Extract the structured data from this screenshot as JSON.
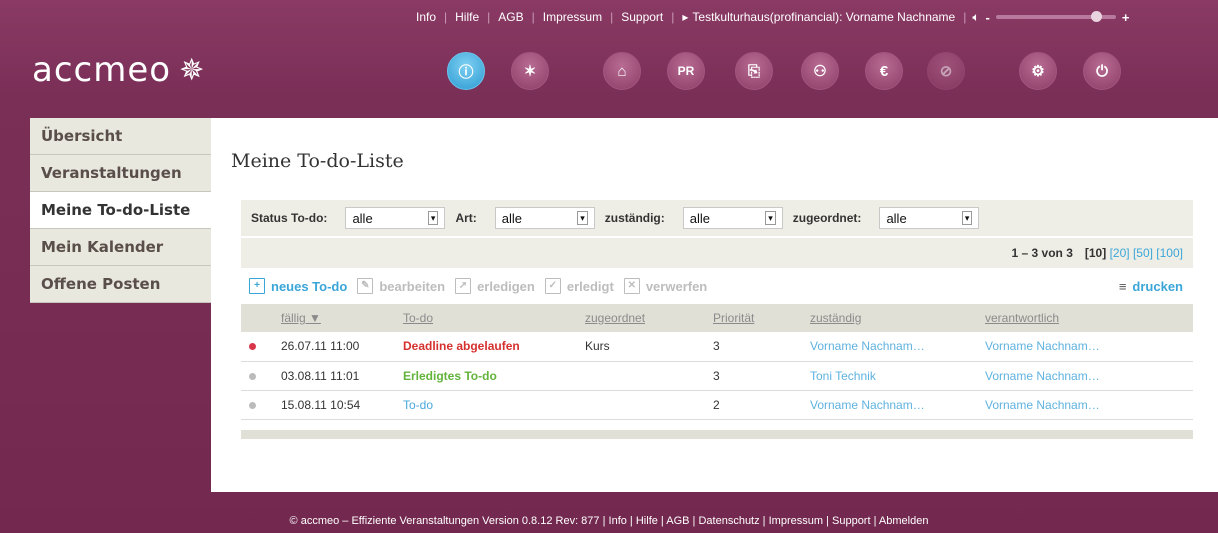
{
  "top_links": [
    "Info",
    "Hilfe",
    "AGB",
    "Impressum",
    "Support"
  ],
  "user_label": "Testkulturhaus(profinancial): Vorname Nachname",
  "volume": {
    "minus": "-",
    "plus": "+",
    "level": 0.85
  },
  "logo": "accmeo",
  "toolbar_icons": [
    {
      "name": "info-icon",
      "glyph": "ⓘ",
      "active": true
    },
    {
      "name": "network-icon",
      "glyph": "✶"
    },
    {
      "name": "home-icon",
      "glyph": "⌂"
    },
    {
      "name": "pr-icon",
      "glyph": "PR"
    },
    {
      "name": "attachment-icon",
      "glyph": "⎘"
    },
    {
      "name": "people-icon",
      "glyph": "⚇"
    },
    {
      "name": "euro-icon",
      "glyph": "€"
    },
    {
      "name": "disabled-icon",
      "glyph": "⊘",
      "dim": true
    },
    {
      "name": "settings-icon",
      "glyph": "⚙"
    },
    {
      "name": "power-icon",
      "glyph": "⏻"
    }
  ],
  "sidebar": {
    "items": [
      {
        "label": "Übersicht"
      },
      {
        "label": "Veranstaltungen"
      },
      {
        "label": "Meine To-do-Liste",
        "active": true
      },
      {
        "label": "Mein Kalender"
      },
      {
        "label": "Offene Posten"
      }
    ]
  },
  "page_title": "Meine To-do-Liste",
  "filter": {
    "status_label": "Status To-do:",
    "status_value": "alle",
    "art_label": "Art:",
    "art_value": "alle",
    "zustaendig_label": "zuständig:",
    "zustaendig_value": "alle",
    "zugeordnet_label": "zugeordnet:",
    "zugeordnet_value": "alle"
  },
  "pager": {
    "range": "1 – 3 von 3",
    "current": "[10]",
    "options": [
      "[20]",
      "[50]",
      "[100]"
    ]
  },
  "actions": {
    "new": "neues To-do",
    "edit": "bearbeiten",
    "complete": "erledigen",
    "done": "erledigt",
    "discard": "verwerfen",
    "print": "drucken"
  },
  "table": {
    "headers": [
      "fällig ▼",
      "To-do",
      "zugeordnet",
      "Priorität",
      "zuständig",
      "verantwortlich"
    ],
    "rows": [
      {
        "due": "26.07.11 11:00",
        "todo": "Deadline abgelaufen",
        "assigned": "Kurs",
        "priority": "3",
        "responsible": "Vorname Nachnam…",
        "accountable": "Vorname Nachnam…"
      },
      {
        "due": "03.08.11 11:01",
        "todo": "Erledigtes To-do",
        "assigned": "",
        "priority": "3",
        "responsible": "Toni Technik",
        "accountable": "Vorname Nachnam…"
      },
      {
        "due": "15.08.11 10:54",
        "todo": "To-do",
        "assigned": "",
        "priority": "2",
        "responsible": "Vorname Nachnam…",
        "accountable": "Vorname Nachnam…"
      }
    ]
  },
  "footer": {
    "text": "© accmeo – Effiziente Veranstaltungen Version 0.8.12 Rev: 877 | ",
    "links": [
      "Info",
      "Hilfe",
      "AGB",
      "Datenschutz",
      "Impressum",
      "Support",
      "Abmelden"
    ]
  }
}
